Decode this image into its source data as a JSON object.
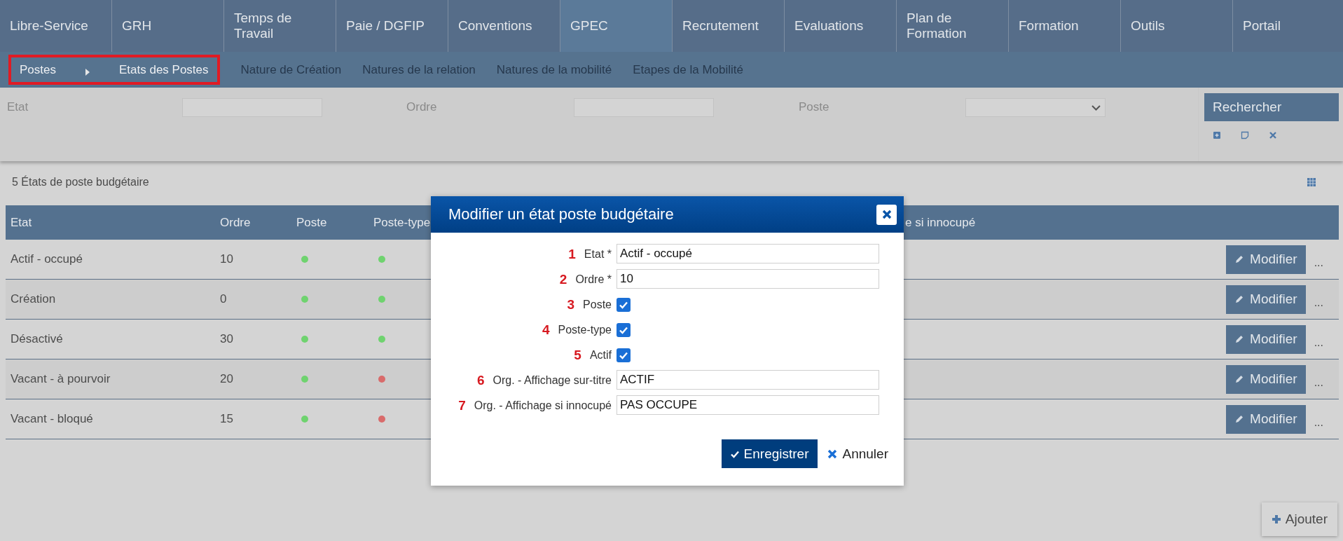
{
  "nav": {
    "tabs": [
      {
        "label": "Libre-Service",
        "selected": false
      },
      {
        "label": "GRH",
        "selected": false
      },
      {
        "label": "Temps de Travail",
        "selected": false
      },
      {
        "label": "Paie / DGFIP",
        "selected": false
      },
      {
        "label": "Conventions",
        "selected": false
      },
      {
        "label": "GPEC",
        "selected": true
      },
      {
        "label": "Recrutement",
        "selected": false
      },
      {
        "label": "Evaluations",
        "selected": false
      },
      {
        "label": "Plan de Formation",
        "selected": false
      },
      {
        "label": "Formation",
        "selected": false
      },
      {
        "label": "Outils",
        "selected": false
      },
      {
        "label": "Portail",
        "selected": false
      }
    ]
  },
  "subnav": {
    "highlighted": true,
    "breadcrumb": [
      "Postes",
      "Etats des Postes"
    ],
    "links": [
      "Nature de Création",
      "Natures de la relation",
      "Natures de la mobilité",
      "Etapes de la Mobilité"
    ]
  },
  "filters": {
    "fields": [
      {
        "label": "Etat",
        "kind": "text"
      },
      {
        "label": "Ordre",
        "kind": "text"
      },
      {
        "label": "Poste",
        "kind": "select"
      }
    ],
    "search_button": "Rechercher"
  },
  "list": {
    "title": "5 États de poste budgétaire",
    "columns": [
      "Etat",
      "Ordre",
      "Poste",
      "Poste-type",
      "e si innocupé"
    ],
    "rows": [
      {
        "etat": "Actif - occupé",
        "ordre": "10",
        "poste": true,
        "poste_type": true,
        "action": "Modifier",
        "more": "..."
      },
      {
        "etat": "Création",
        "ordre": "0",
        "poste": true,
        "poste_type": true,
        "action": "Modifier",
        "more": "..."
      },
      {
        "etat": "Désactivé",
        "ordre": "30",
        "poste": true,
        "poste_type": true,
        "action": "Modifier",
        "more": "..."
      },
      {
        "etat": "Vacant - à pourvoir",
        "ordre": "20",
        "poste": true,
        "poste_type": false,
        "action": "Modifier",
        "more": "..."
      },
      {
        "etat": "Vacant - bloqué",
        "ordre": "15",
        "poste": true,
        "poste_type": false,
        "action": "Modifier",
        "more": "..."
      }
    ],
    "add_button": "Ajouter"
  },
  "modal": {
    "title": "Modifier un état poste budgétaire",
    "fields": [
      {
        "marker": "1",
        "label": "Etat *",
        "kind": "text",
        "value": "Actif - occupé"
      },
      {
        "marker": "2",
        "label": "Ordre *",
        "kind": "text",
        "value": "10"
      },
      {
        "marker": "3",
        "label": "Poste",
        "kind": "checkbox",
        "checked": true
      },
      {
        "marker": "4",
        "label": "Poste-type",
        "kind": "checkbox",
        "checked": true
      },
      {
        "marker": "5",
        "label": "Actif",
        "kind": "checkbox",
        "checked": true
      },
      {
        "marker": "6",
        "label": "Org. - Affichage sur-titre",
        "kind": "text",
        "value": "ACTIF"
      },
      {
        "marker": "7",
        "label": "Org. - Affichage si innocupé",
        "kind": "text",
        "value": "PAS OCCUPE"
      }
    ],
    "save_button": "Enregistrer",
    "cancel_button": "Annuler"
  }
}
